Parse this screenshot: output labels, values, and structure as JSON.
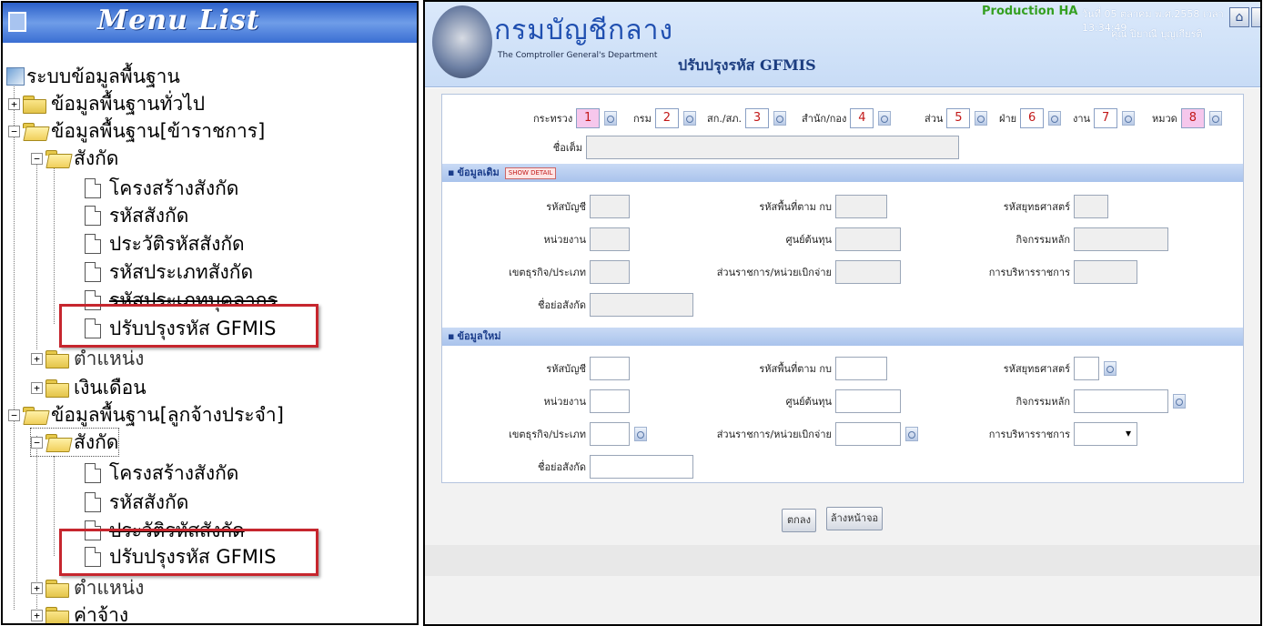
{
  "menu": {
    "title": "Menu List",
    "root": "ระบบข้อมูลพื้นฐาน",
    "items": [
      {
        "label": "ข้อมูลพื้นฐานทั่วไป"
      },
      {
        "label": "ข้อมูลพื้นฐาน[ข้าราชการ]"
      },
      {
        "label": "สังกัด"
      },
      {
        "label": "โครงสร้างสังกัด"
      },
      {
        "label": "รหัสสังกัด"
      },
      {
        "label": "ประวัติรหัสสังกัด"
      },
      {
        "label": "รหัสประเภทสังกัด"
      },
      {
        "label": "รหัสประเภทบุคลากร"
      },
      {
        "label": "ปรับปรุงรหัส GFMIS"
      },
      {
        "label": "ตำแหน่ง"
      },
      {
        "label": "เงินเดือน"
      },
      {
        "label": "ข้อมูลพื้นฐาน[ลูกจ้างประจำ]"
      },
      {
        "label": "สังกัด"
      },
      {
        "label": "โครงสร้างสังกัด"
      },
      {
        "label": "รหัสสังกัด"
      },
      {
        "label": "ประวัติรหัสสังกัด"
      },
      {
        "label": "ปรับปรุงรหัส GFMIS"
      },
      {
        "label": "ตำแหน่ง"
      },
      {
        "label": "ค่าจ้าง"
      }
    ]
  },
  "header": {
    "org_name": "กรมบัญชีกลาง",
    "org_sub": "The Comptroller General's Department",
    "page_title": "ปรับปรุงรหัส GFMIS",
    "environment": "Production HA",
    "datetime": "วันที่ 05 ตุลาคม พ.ศ.2558 เวลา 13:34:49",
    "user": "คุณ ปิยาณี บุญเกียรติ",
    "home_icon": "home-icon",
    "exit_icon": "exit-icon"
  },
  "codes": [
    {
      "label": "กระทรวง",
      "value": "1"
    },
    {
      "label": "กรม",
      "value": "2"
    },
    {
      "label": "สก./สภ.",
      "value": "3"
    },
    {
      "label": "สำนัก/กอง",
      "value": "4"
    },
    {
      "label": "ส่วน",
      "value": "5"
    },
    {
      "label": "ฝ่าย",
      "value": "6"
    },
    {
      "label": "งาน",
      "value": "7"
    },
    {
      "label": "หมวด",
      "value": "8"
    }
  ],
  "short_name_label": "ชื่อเต็ม",
  "old_section": {
    "title": "ข้อมูลเดิม",
    "show_detail": "SHOW DETAIL",
    "fields": {
      "account_code": "รหัสบัญชี",
      "area_code": "รหัสพื้นที่ตาม กบ",
      "strategy_code": "รหัสยุทธศาสตร์",
      "unit": "หน่วยงาน",
      "cost_center": "ศูนย์ต้นทุน",
      "main_activity": "กิจกรรมหลัก",
      "district": "เขตธุรกิจ/ประเภท",
      "disbursing_unit": "ส่วนราชการ/หน่วยเบิกจ่าย",
      "admin_mgmt": "การบริหารราชการ",
      "short_name": "ชื่อย่อสังกัด"
    }
  },
  "new_section": {
    "title": "ข้อมูลใหม่",
    "fields": {
      "account_code": "รหัสบัญชี",
      "area_code": "รหัสพื้นที่ตาม กบ",
      "strategy_code": "รหัสยุทธศาสตร์",
      "unit": "หน่วยงาน",
      "cost_center": "ศูนย์ต้นทุน",
      "main_activity": "กิจกรรมหลัก",
      "district": "เขตธุรกิจ/ประเภท",
      "disbursing_unit": "ส่วนราชการ/หน่วยเบิกจ่าย",
      "admin_mgmt": "การบริหารราชการ",
      "short_name": "ชื่อย่อสังกัด"
    }
  },
  "buttons": {
    "ok": "ตกลง",
    "clear": "ล้างหน้าจอ"
  },
  "colors": {
    "highlight": "#c6262e",
    "header_blue": "#2a5fc9",
    "section_bar": "#c9daf5",
    "code_value": "#c21818",
    "env_green": "#35a022"
  }
}
